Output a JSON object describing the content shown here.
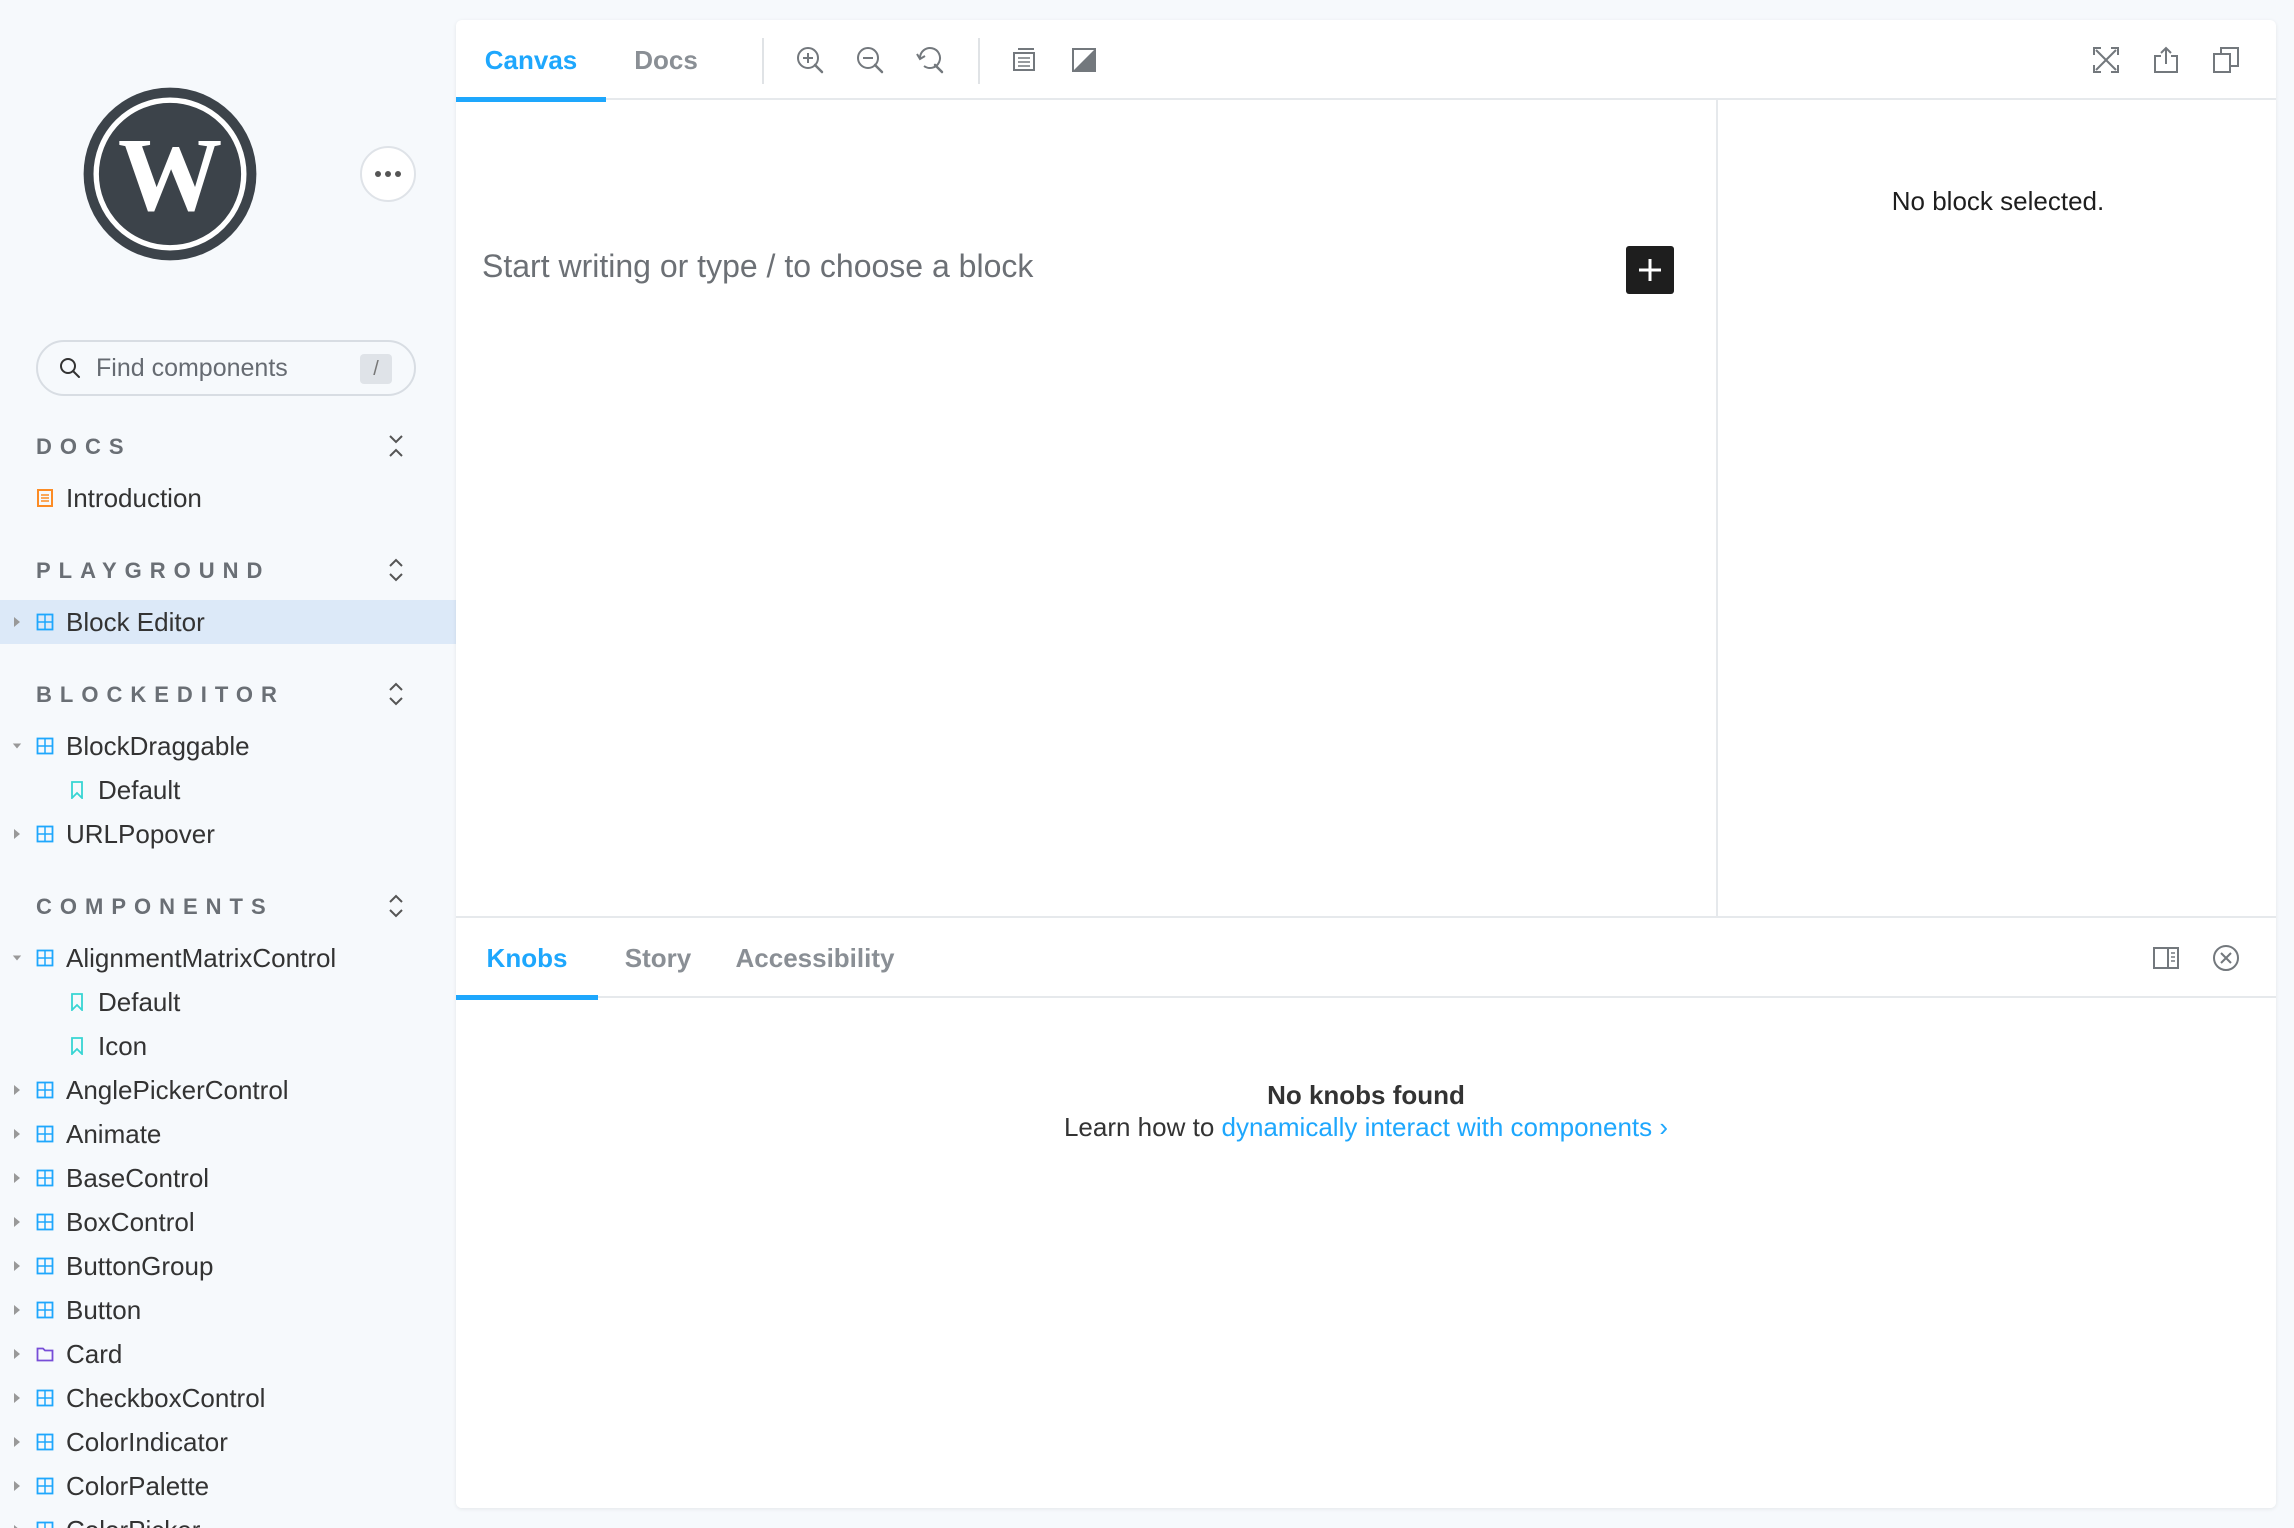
{
  "sidebar": {
    "logo": "wordpress-logo",
    "menu_icon": "ellipsis-icon",
    "search": {
      "placeholder": "Find components",
      "shortcut": "/"
    },
    "sections": [
      {
        "title": "DOCS",
        "toggle": "collapse-all-icon"
      },
      {
        "title": "PLAYGROUND",
        "toggle": "expand-collapse-icon"
      },
      {
        "title": "BLOCKEDITOR",
        "toggle": "expand-collapse-icon"
      },
      {
        "title": "COMPONENTS",
        "toggle": "expand-collapse-icon"
      }
    ],
    "docs_items": [
      {
        "label": "Introduction",
        "icon": "document-icon"
      }
    ],
    "playground_items": [
      {
        "label": "Block Editor",
        "icon": "component-icon",
        "active": true
      }
    ],
    "blockeditor_items": [
      {
        "label": "BlockDraggable",
        "icon": "component-icon",
        "expanded": true
      },
      {
        "label": "Default",
        "icon": "bookmark-icon",
        "child": true
      },
      {
        "label": "URLPopover",
        "icon": "component-icon"
      }
    ],
    "components_items": [
      {
        "label": "AlignmentMatrixControl",
        "icon": "component-icon",
        "expanded": true
      },
      {
        "label": "Default",
        "icon": "bookmark-icon",
        "child": true
      },
      {
        "label": "Icon",
        "icon": "bookmark-icon",
        "child": true
      },
      {
        "label": "AnglePickerControl",
        "icon": "component-icon"
      },
      {
        "label": "Animate",
        "icon": "component-icon"
      },
      {
        "label": "BaseControl",
        "icon": "component-icon"
      },
      {
        "label": "BoxControl",
        "icon": "component-icon"
      },
      {
        "label": "ButtonGroup",
        "icon": "component-icon"
      },
      {
        "label": "Button",
        "icon": "component-icon"
      },
      {
        "label": "Card",
        "icon": "folder-icon"
      },
      {
        "label": "CheckboxControl",
        "icon": "component-icon"
      },
      {
        "label": "ColorIndicator",
        "icon": "component-icon"
      },
      {
        "label": "ColorPalette",
        "icon": "component-icon"
      },
      {
        "label": "ColorPicker",
        "icon": "component-icon"
      }
    ]
  },
  "toolbar": {
    "tabs": [
      {
        "label": "Canvas",
        "active": true
      },
      {
        "label": "Docs"
      }
    ],
    "tools": [
      "zoom-in-icon",
      "zoom-out-icon",
      "reset-zoom-icon",
      "background-icon",
      "contrast-icon"
    ],
    "right_tools": [
      "fullscreen-icon",
      "share-icon",
      "copy-link-icon"
    ]
  },
  "canvas": {
    "placeholder": "Start writing or type / to choose a block",
    "add_block_icon": "plus-icon"
  },
  "inspector": {
    "message": "No block selected."
  },
  "addons": {
    "tabs": [
      {
        "label": "Knobs",
        "active": true
      },
      {
        "label": "Story"
      },
      {
        "label": "Accessibility"
      }
    ],
    "right_tools": [
      "panel-orientation-icon",
      "close-icon"
    ],
    "empty_title": "No knobs found",
    "empty_text": "Learn how to ",
    "empty_link": "dynamically interact with components",
    "empty_link_suffix": " ›"
  },
  "colors": {
    "accent": "#1ea7fd",
    "active_nav_bg": "#dce9f8",
    "component_icon": "#1ea7fd",
    "doc_icon": "#fc8c25",
    "bookmark_icon": "#37d5d3",
    "folder_icon": "#774dd7"
  }
}
